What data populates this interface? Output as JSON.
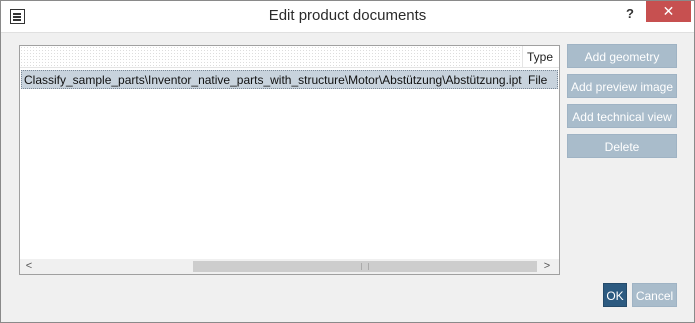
{
  "window": {
    "title": "Edit product documents",
    "help_label": "?",
    "close_label": "✕"
  },
  "grid": {
    "columns": [
      "",
      "Type"
    ],
    "rows": [
      {
        "path": "Classify_sample_parts\\Inventor_native_parts_with_structure\\Motor\\Abstützung\\Abstützung.ipt",
        "type": "File"
      }
    ],
    "scroll_left": "<",
    "scroll_right": ">"
  },
  "actions": {
    "add_geometry": "Add geometry",
    "add_preview_image": "Add preview image",
    "add_technical_view": "Add technical view",
    "delete": "Delete"
  },
  "footer": {
    "ok": "OK",
    "cancel": "Cancel"
  },
  "colors": {
    "accent": "#2c5a80",
    "disabled_button": "#a9bccb",
    "selected_row": "#c8d3dd",
    "close_button": "#c75050"
  }
}
